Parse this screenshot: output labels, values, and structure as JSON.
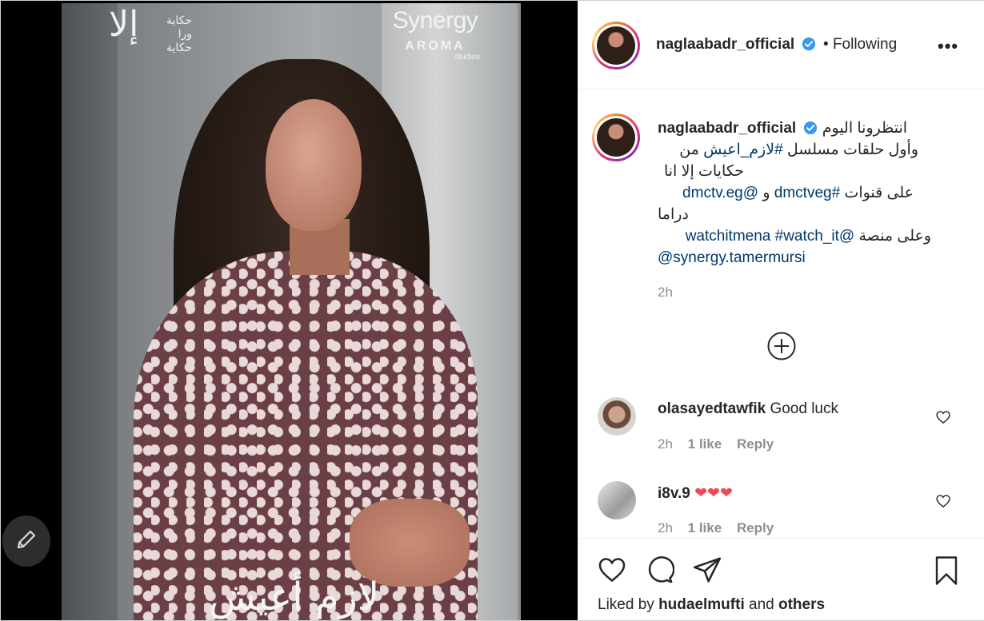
{
  "post": {
    "overlay": {
      "logo_left_mark": "إلا",
      "logo_left_lines": [
        "حكاية",
        "ورا",
        "حكاية"
      ],
      "logo_right_line1": "Synergy",
      "logo_right_line2": "AROMA",
      "logo_right_line3": "studios",
      "bottom_title": "لازم أعيش"
    }
  },
  "header": {
    "username": "naglaabadr_official",
    "separator": "•",
    "follow_status": "Following",
    "more_label": "•••"
  },
  "caption": {
    "username": "naglaabadr_official",
    "line1": "انتظرونا اليوم",
    "line2_text": "وأول حلقات مسلسل",
    "line2_tag": "#لازم_اعيش",
    "line2_end": "من",
    "line3": "حكايات إلا انا",
    "line4_mention": "@dmctv.eg",
    "line4_and": "و",
    "line4_tag": "#dmctveg",
    "line4_end": "على قنوات",
    "line5": "دراما",
    "line6_mention": "@watchitmena",
    "line6_tag": "#watch_it",
    "line6_end": "وعلى منصة",
    "line7_mention": "@synergy.tamermursi",
    "time": "2h"
  },
  "comments": [
    {
      "username": "olasayedtawfik",
      "text": "Good luck",
      "time": "2h",
      "likes": "1 like",
      "reply": "Reply"
    },
    {
      "username": "i8v.9",
      "text": "❤❤❤",
      "time": "2h",
      "likes": "1 like",
      "reply": "Reply"
    }
  ],
  "footer": {
    "liked_by_prefix": "Liked by",
    "liked_by_user": "hudaelmufti",
    "liked_by_and": "and",
    "liked_by_others": "others"
  },
  "colors": {
    "link": "#00376b",
    "verified": "#3897f0",
    "heart": "#ed4956",
    "muted": "#8e8e8e"
  }
}
